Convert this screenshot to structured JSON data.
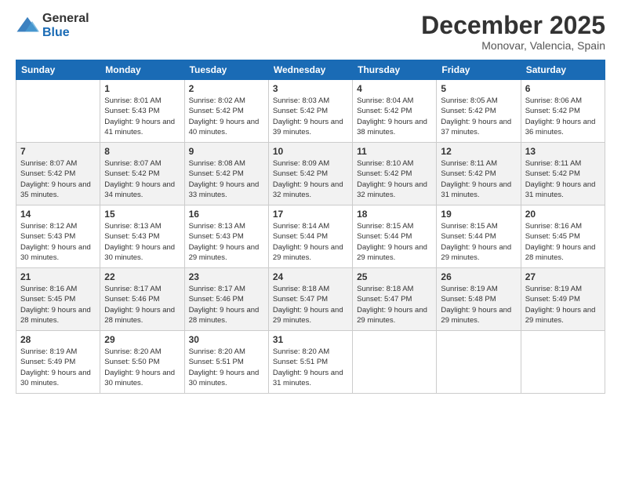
{
  "logo": {
    "general": "General",
    "blue": "Blue"
  },
  "header": {
    "month": "December 2025",
    "location": "Monovar, Valencia, Spain"
  },
  "days": [
    "Sunday",
    "Monday",
    "Tuesday",
    "Wednesday",
    "Thursday",
    "Friday",
    "Saturday"
  ],
  "weeks": [
    [
      {
        "date": "",
        "sunrise": "",
        "sunset": "",
        "daylight": ""
      },
      {
        "date": "1",
        "sunrise": "Sunrise: 8:01 AM",
        "sunset": "Sunset: 5:43 PM",
        "daylight": "Daylight: 9 hours and 41 minutes."
      },
      {
        "date": "2",
        "sunrise": "Sunrise: 8:02 AM",
        "sunset": "Sunset: 5:42 PM",
        "daylight": "Daylight: 9 hours and 40 minutes."
      },
      {
        "date": "3",
        "sunrise": "Sunrise: 8:03 AM",
        "sunset": "Sunset: 5:42 PM",
        "daylight": "Daylight: 9 hours and 39 minutes."
      },
      {
        "date": "4",
        "sunrise": "Sunrise: 8:04 AM",
        "sunset": "Sunset: 5:42 PM",
        "daylight": "Daylight: 9 hours and 38 minutes."
      },
      {
        "date": "5",
        "sunrise": "Sunrise: 8:05 AM",
        "sunset": "Sunset: 5:42 PM",
        "daylight": "Daylight: 9 hours and 37 minutes."
      },
      {
        "date": "6",
        "sunrise": "Sunrise: 8:06 AM",
        "sunset": "Sunset: 5:42 PM",
        "daylight": "Daylight: 9 hours and 36 minutes."
      }
    ],
    [
      {
        "date": "7",
        "sunrise": "Sunrise: 8:07 AM",
        "sunset": "Sunset: 5:42 PM",
        "daylight": "Daylight: 9 hours and 35 minutes."
      },
      {
        "date": "8",
        "sunrise": "Sunrise: 8:07 AM",
        "sunset": "Sunset: 5:42 PM",
        "daylight": "Daylight: 9 hours and 34 minutes."
      },
      {
        "date": "9",
        "sunrise": "Sunrise: 8:08 AM",
        "sunset": "Sunset: 5:42 PM",
        "daylight": "Daylight: 9 hours and 33 minutes."
      },
      {
        "date": "10",
        "sunrise": "Sunrise: 8:09 AM",
        "sunset": "Sunset: 5:42 PM",
        "daylight": "Daylight: 9 hours and 32 minutes."
      },
      {
        "date": "11",
        "sunrise": "Sunrise: 8:10 AM",
        "sunset": "Sunset: 5:42 PM",
        "daylight": "Daylight: 9 hours and 32 minutes."
      },
      {
        "date": "12",
        "sunrise": "Sunrise: 8:11 AM",
        "sunset": "Sunset: 5:42 PM",
        "daylight": "Daylight: 9 hours and 31 minutes."
      },
      {
        "date": "13",
        "sunrise": "Sunrise: 8:11 AM",
        "sunset": "Sunset: 5:42 PM",
        "daylight": "Daylight: 9 hours and 31 minutes."
      }
    ],
    [
      {
        "date": "14",
        "sunrise": "Sunrise: 8:12 AM",
        "sunset": "Sunset: 5:43 PM",
        "daylight": "Daylight: 9 hours and 30 minutes."
      },
      {
        "date": "15",
        "sunrise": "Sunrise: 8:13 AM",
        "sunset": "Sunset: 5:43 PM",
        "daylight": "Daylight: 9 hours and 30 minutes."
      },
      {
        "date": "16",
        "sunrise": "Sunrise: 8:13 AM",
        "sunset": "Sunset: 5:43 PM",
        "daylight": "Daylight: 9 hours and 29 minutes."
      },
      {
        "date": "17",
        "sunrise": "Sunrise: 8:14 AM",
        "sunset": "Sunset: 5:44 PM",
        "daylight": "Daylight: 9 hours and 29 minutes."
      },
      {
        "date": "18",
        "sunrise": "Sunrise: 8:15 AM",
        "sunset": "Sunset: 5:44 PM",
        "daylight": "Daylight: 9 hours and 29 minutes."
      },
      {
        "date": "19",
        "sunrise": "Sunrise: 8:15 AM",
        "sunset": "Sunset: 5:44 PM",
        "daylight": "Daylight: 9 hours and 29 minutes."
      },
      {
        "date": "20",
        "sunrise": "Sunrise: 8:16 AM",
        "sunset": "Sunset: 5:45 PM",
        "daylight": "Daylight: 9 hours and 28 minutes."
      }
    ],
    [
      {
        "date": "21",
        "sunrise": "Sunrise: 8:16 AM",
        "sunset": "Sunset: 5:45 PM",
        "daylight": "Daylight: 9 hours and 28 minutes."
      },
      {
        "date": "22",
        "sunrise": "Sunrise: 8:17 AM",
        "sunset": "Sunset: 5:46 PM",
        "daylight": "Daylight: 9 hours and 28 minutes."
      },
      {
        "date": "23",
        "sunrise": "Sunrise: 8:17 AM",
        "sunset": "Sunset: 5:46 PM",
        "daylight": "Daylight: 9 hours and 28 minutes."
      },
      {
        "date": "24",
        "sunrise": "Sunrise: 8:18 AM",
        "sunset": "Sunset: 5:47 PM",
        "daylight": "Daylight: 9 hours and 29 minutes."
      },
      {
        "date": "25",
        "sunrise": "Sunrise: 8:18 AM",
        "sunset": "Sunset: 5:47 PM",
        "daylight": "Daylight: 9 hours and 29 minutes."
      },
      {
        "date": "26",
        "sunrise": "Sunrise: 8:19 AM",
        "sunset": "Sunset: 5:48 PM",
        "daylight": "Daylight: 9 hours and 29 minutes."
      },
      {
        "date": "27",
        "sunrise": "Sunrise: 8:19 AM",
        "sunset": "Sunset: 5:49 PM",
        "daylight": "Daylight: 9 hours and 29 minutes."
      }
    ],
    [
      {
        "date": "28",
        "sunrise": "Sunrise: 8:19 AM",
        "sunset": "Sunset: 5:49 PM",
        "daylight": "Daylight: 9 hours and 30 minutes."
      },
      {
        "date": "29",
        "sunrise": "Sunrise: 8:20 AM",
        "sunset": "Sunset: 5:50 PM",
        "daylight": "Daylight: 9 hours and 30 minutes."
      },
      {
        "date": "30",
        "sunrise": "Sunrise: 8:20 AM",
        "sunset": "Sunset: 5:51 PM",
        "daylight": "Daylight: 9 hours and 30 minutes."
      },
      {
        "date": "31",
        "sunrise": "Sunrise: 8:20 AM",
        "sunset": "Sunset: 5:51 PM",
        "daylight": "Daylight: 9 hours and 31 minutes."
      },
      {
        "date": "",
        "sunrise": "",
        "sunset": "",
        "daylight": ""
      },
      {
        "date": "",
        "sunrise": "",
        "sunset": "",
        "daylight": ""
      },
      {
        "date": "",
        "sunrise": "",
        "sunset": "",
        "daylight": ""
      }
    ]
  ]
}
